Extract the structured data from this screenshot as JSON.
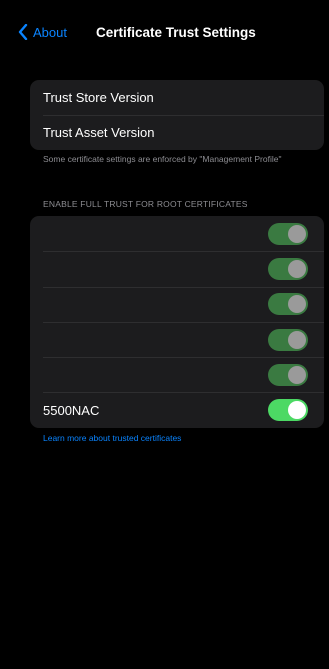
{
  "nav": {
    "back_label": "About",
    "title": "Certificate Trust Settings"
  },
  "info_rows": [
    {
      "label": "Trust Store Version"
    },
    {
      "label": "Trust Asset Version"
    }
  ],
  "footnote": "Some certificate settings are enforced by \"Management Profile\"",
  "section_header": "ENABLE FULL TRUST FOR ROOT CERTIFICATES",
  "certificates": [
    {
      "label": "",
      "enabled": true
    },
    {
      "label": "",
      "enabled": true
    },
    {
      "label": "",
      "enabled": true
    },
    {
      "label": "",
      "enabled": true
    },
    {
      "label": "",
      "enabled": true
    },
    {
      "label": "5500NAC",
      "enabled": true
    }
  ],
  "learn_more": "Learn more about trusted certificates",
  "colors": {
    "accent": "#0a84ff",
    "toggle_on": "#4cd964",
    "toggle_on_dimmed": "#3a7a41",
    "group_bg": "#1c1c1e",
    "secondary_text": "#8d8d92"
  },
  "icons": {
    "back": "chevron-left-icon"
  }
}
